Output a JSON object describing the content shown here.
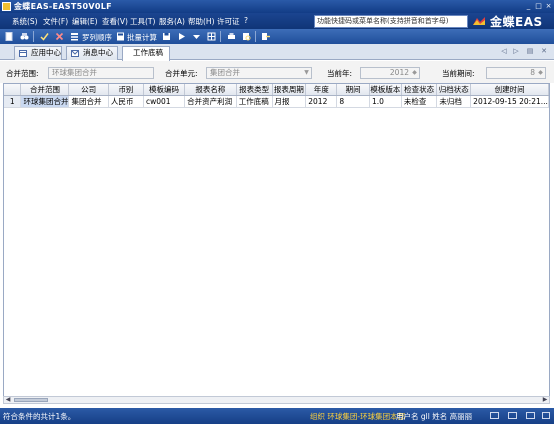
{
  "window": {
    "title": "金蝶EAS-EAST50V0LF"
  },
  "menu": {
    "items": [
      "系统(S)",
      "文件(F)",
      "编辑(E)",
      "查看(V)",
      "工具(T)",
      "服务(A)",
      "帮助(H)",
      "许可证",
      "?"
    ],
    "search_placeholder": "功能快捷码或菜单名称(支持拼音和首字母)",
    "logo_text": "金蝶EAS"
  },
  "toolbar": {
    "arrange_label": "罗列顺序",
    "batch_calc_label": "批量计算"
  },
  "tabs": [
    {
      "label": "应用中心",
      "icon": "app-center-icon",
      "active": false
    },
    {
      "label": "消息中心",
      "icon": "message-center-icon",
      "active": false
    },
    {
      "label": "工作底稿",
      "icon": "",
      "active": true
    }
  ],
  "filters": {
    "scope_label": "合并范围:",
    "scope_value": "环球集团合并",
    "unit_label": "合并单元:",
    "unit_value": "集团合并",
    "year_label": "当前年:",
    "year_value": "2012",
    "period_label": "当前期间:",
    "period_value": "8"
  },
  "grid": {
    "columns": [
      "合并范围",
      "公司",
      "币别",
      "模板编码",
      "报表名称",
      "报表类型",
      "报表周期",
      "年度",
      "期间",
      "模板版本",
      "检查状态",
      "归档状态",
      "创建时间"
    ],
    "rows": [
      {
        "num": "1",
        "cells": [
          "环球集团合并",
          "集团合并",
          "人民币",
          "cw001",
          "合并资产利润",
          "工作底稿",
          "月报",
          "2012",
          "8",
          "1.0",
          "未检查",
          "未归档",
          "2012-09-15 20:21..."
        ]
      }
    ]
  },
  "status": {
    "left": "符合条件的共计1条。",
    "org": "组织 环球集团-环球集团本部",
    "user": "用户名 gll 姓名 高丽丽"
  },
  "colors": {
    "title_bar": "#1b4590",
    "status_org_text": "#ffd23c",
    "selected_row": "#c9d8f0"
  }
}
